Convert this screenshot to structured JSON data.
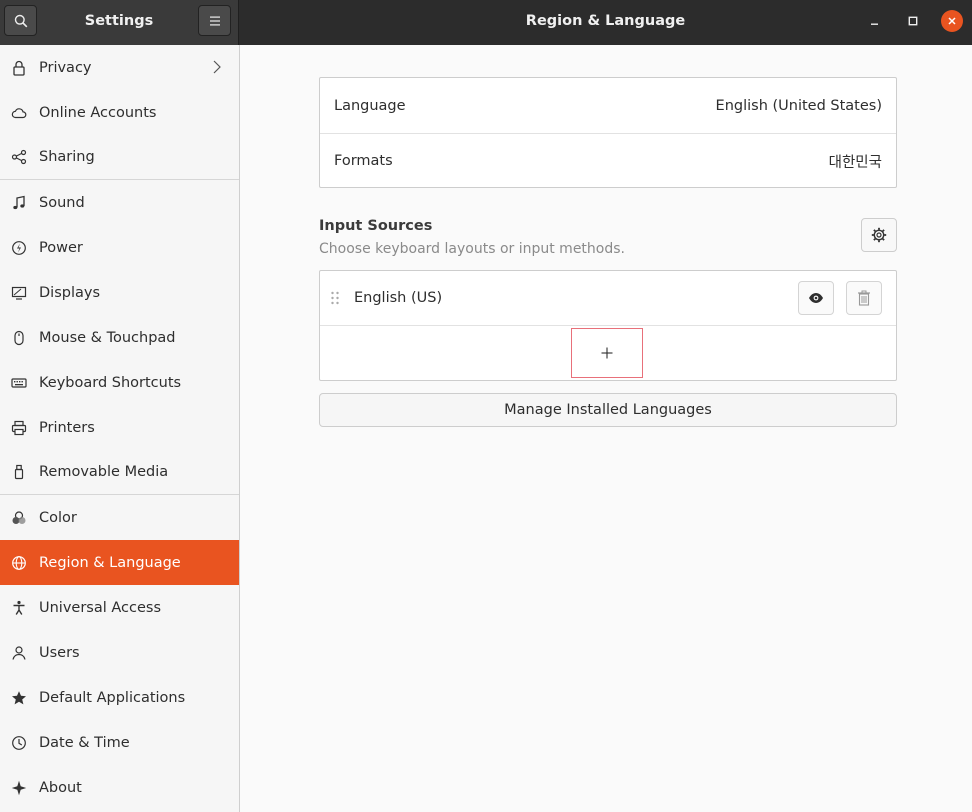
{
  "window": {
    "sidebar_title": "Settings",
    "title": "Region & Language"
  },
  "sidebar": {
    "items": [
      {
        "label": "Privacy",
        "icon": "lock-icon"
      },
      {
        "label": "Online Accounts",
        "icon": "cloud-icon"
      },
      {
        "label": "Sharing",
        "icon": "share-icon"
      },
      {
        "label": "Sound",
        "icon": "music-note-icon"
      },
      {
        "label": "Power",
        "icon": "power-icon"
      },
      {
        "label": "Displays",
        "icon": "display-icon"
      },
      {
        "label": "Mouse & Touchpad",
        "icon": "mouse-icon"
      },
      {
        "label": "Keyboard Shortcuts",
        "icon": "keyboard-icon"
      },
      {
        "label": "Printers",
        "icon": "printer-icon"
      },
      {
        "label": "Removable Media",
        "icon": "usb-icon"
      },
      {
        "label": "Color",
        "icon": "color-icon"
      },
      {
        "label": "Region & Language",
        "icon": "globe-icon"
      },
      {
        "label": "Universal Access",
        "icon": "accessibility-icon"
      },
      {
        "label": "Users",
        "icon": "user-icon"
      },
      {
        "label": "Default Applications",
        "icon": "star-icon"
      },
      {
        "label": "Date & Time",
        "icon": "clock-icon"
      },
      {
        "label": "About",
        "icon": "sparkle-icon"
      }
    ],
    "active": "Region & Language"
  },
  "main": {
    "language_label": "Language",
    "language_value": "English (United States)",
    "formats_label": "Formats",
    "formats_value": "대한민국",
    "input_sources_title": "Input Sources",
    "input_sources_subtitle": "Choose keyboard layouts or input methods.",
    "sources": [
      {
        "label": "English (US)"
      }
    ],
    "add_symbol": "+",
    "manage_button": "Manage Installed Languages"
  },
  "colors": {
    "accent": "#e95420",
    "headerbar": "#2c2c2c",
    "focus_outline": "#e8707a"
  }
}
